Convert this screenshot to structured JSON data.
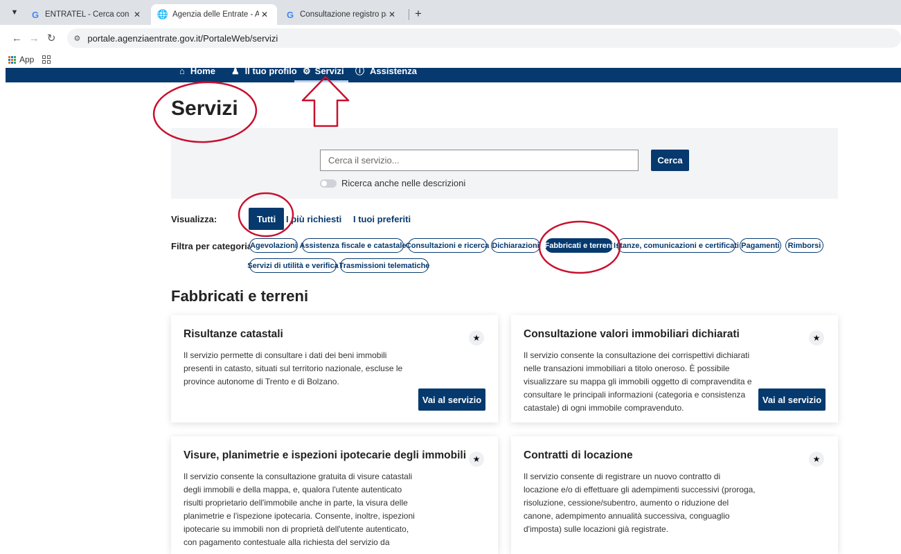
{
  "browser": {
    "tabs": [
      {
        "title": "ENTRATEL - Cerca con Google",
        "favicon": "google-icon",
        "active": false
      },
      {
        "title": "Agenzia delle Entrate - Area ris",
        "favicon": "globe-icon",
        "active": true
      },
      {
        "title": "Consultazione registro partite d",
        "favicon": "google-icon",
        "active": false
      }
    ],
    "new_tab": "+",
    "url": "portale.agenziaentrate.gov.it/PortaleWeb/servizi",
    "bookmarks": {
      "apps_label": "App"
    }
  },
  "site_nav": {
    "items": [
      {
        "label": "Home",
        "icon": "home-icon"
      },
      {
        "label": "Il tuo profilo",
        "icon": "user-icon"
      },
      {
        "label": "Servizi",
        "icon": "gears-icon",
        "active": true
      },
      {
        "label": "Assistenza",
        "icon": "info-icon"
      }
    ]
  },
  "page": {
    "title": "Servizi",
    "search": {
      "placeholder": "Cerca il servizio...",
      "button": "Cerca",
      "toggle_label": "Ricerca anche nelle descrizioni"
    },
    "view": {
      "label": "Visualizza:",
      "tabs": [
        "Tutti",
        "I più richiesti",
        "I tuoi preferiti"
      ],
      "active": "Tutti"
    },
    "filter": {
      "label": "Filtra per categoria:",
      "chips": [
        "Agevolazioni",
        "Assistenza fiscale e catastale",
        "Consultazioni e ricerca",
        "Dichiarazioni",
        "Fabbricati e terreni",
        "Istanze, comunicazioni e certificati",
        "Pagamenti",
        "Rimborsi",
        "Servizi di utilità e verifica",
        "Trasmissioni telematiche"
      ],
      "active": "Fabbricati e terreni"
    },
    "section_title": "Fabbricati e terreni",
    "cards": [
      {
        "title": "Risultanze catastali",
        "description": "Il servizio permette di consultare i dati dei beni immobili presenti in catasto, situati sul territorio nazionale, escluse le province autonome di Trento e di Bolzano.",
        "button": "Vai al servizio"
      },
      {
        "title": "Consultazione valori immobiliari dichiarati",
        "description": "Il servizio consente la consultazione dei corrispettivi dichiarati nelle transazioni immobiliari a titolo oneroso. È possibile visualizzare su mappa gli immobili oggetto di compravendita e consultare le principali informazioni (categoria e consistenza catastale) di ogni immobile compravenduto.",
        "button": "Vai al servizio"
      },
      {
        "title": "Visure, planimetrie e ispezioni ipotecarie degli immobili",
        "description": "Il servizio consente la consultazione gratuita di visure catastali degli immobili e della mappa, e, qualora l'utente autenticato risulti proprietario dell'immobile anche in parte, la visura delle planimetrie e l'ispezione ipotecaria. Consente, inoltre, ispezioni ipotecarie su immobili non di proprietà dell'utente autenticato, con pagamento contestuale alla richiesta del servizio da"
      },
      {
        "title": "Contratti di locazione",
        "description": "Il servizio consente di registrare un nuovo contratto di locazione e/o di effettuare gli adempimenti successivi (proroga, risoluzione, cessione/subentro, aumento o riduzione del canone, adempimento annualità successiva, conguaglio d'imposta) sulle locazioni già registrate."
      }
    ]
  },
  "annotation_color": "#c8102e"
}
